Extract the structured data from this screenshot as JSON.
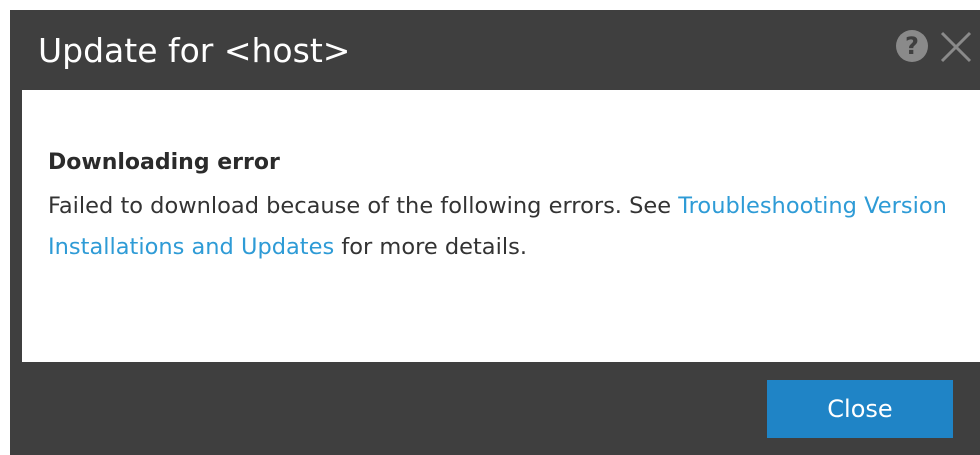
{
  "dialog": {
    "title": "Update for <host>",
    "help_icon": "help-icon",
    "close_icon": "close-icon",
    "heading": "Downloading error",
    "message_before_link": "Failed to download because of the following errors. See ",
    "link_text": "Troubleshooting Version Installations and Updates",
    "message_after_link": " for more details.",
    "close_button_label": "Close"
  },
  "colors": {
    "dialog_background": "#3f3f3f",
    "content_background": "#ffffff",
    "link": "#2e9bd6",
    "button": "#1f84c6"
  }
}
